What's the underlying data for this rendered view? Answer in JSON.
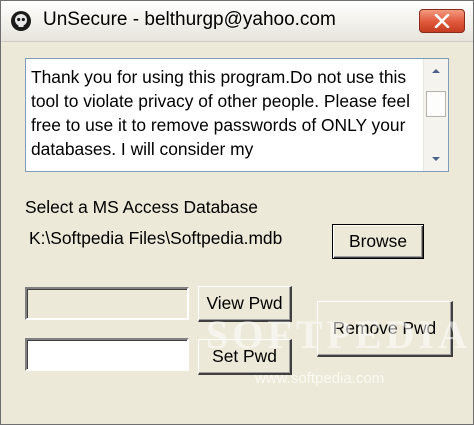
{
  "window": {
    "title": "UnSecure - belthurgp@yahoo.com"
  },
  "message": {
    "text": "Thank you for using this program.Do not use this tool to violate privacy of other people. Please feel free to use it to remove passwords of ONLY your databases. I will consider my"
  },
  "database": {
    "label": "Select a MS Access Database",
    "path": "K:\\Softpedia Files\\Softpedia.mdb",
    "browse_label": "Browse"
  },
  "password": {
    "view_label": "View Pwd",
    "set_label": "Set Pwd",
    "view_value": "",
    "set_value": "",
    "remove_label": "Remove Pwd"
  },
  "watermark": {
    "text": "SOFTPEDIA",
    "url": "www.softpedia.com"
  },
  "icons": {
    "app": "skull-icon",
    "close": "close-icon",
    "scroll_up": "arrow-up-icon",
    "scroll_down": "arrow-down-icon"
  },
  "colors": {
    "close_button": "#e0573a",
    "dialog_background": "#ece9d8"
  }
}
